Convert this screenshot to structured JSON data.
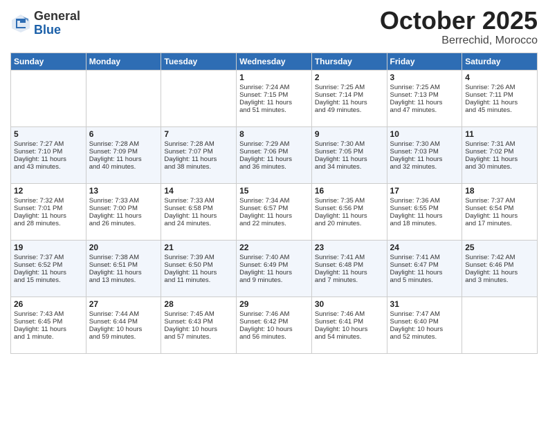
{
  "header": {
    "logo_line1": "General",
    "logo_line2": "Blue",
    "month": "October 2025",
    "location": "Berrechid, Morocco"
  },
  "weekdays": [
    "Sunday",
    "Monday",
    "Tuesday",
    "Wednesday",
    "Thursday",
    "Friday",
    "Saturday"
  ],
  "weeks": [
    [
      {
        "day": "",
        "data": ""
      },
      {
        "day": "",
        "data": ""
      },
      {
        "day": "",
        "data": ""
      },
      {
        "day": "1",
        "data": "Sunrise: 7:24 AM\nSunset: 7:15 PM\nDaylight: 11 hours\nand 51 minutes."
      },
      {
        "day": "2",
        "data": "Sunrise: 7:25 AM\nSunset: 7:14 PM\nDaylight: 11 hours\nand 49 minutes."
      },
      {
        "day": "3",
        "data": "Sunrise: 7:25 AM\nSunset: 7:13 PM\nDaylight: 11 hours\nand 47 minutes."
      },
      {
        "day": "4",
        "data": "Sunrise: 7:26 AM\nSunset: 7:11 PM\nDaylight: 11 hours\nand 45 minutes."
      }
    ],
    [
      {
        "day": "5",
        "data": "Sunrise: 7:27 AM\nSunset: 7:10 PM\nDaylight: 11 hours\nand 43 minutes."
      },
      {
        "day": "6",
        "data": "Sunrise: 7:28 AM\nSunset: 7:09 PM\nDaylight: 11 hours\nand 40 minutes."
      },
      {
        "day": "7",
        "data": "Sunrise: 7:28 AM\nSunset: 7:07 PM\nDaylight: 11 hours\nand 38 minutes."
      },
      {
        "day": "8",
        "data": "Sunrise: 7:29 AM\nSunset: 7:06 PM\nDaylight: 11 hours\nand 36 minutes."
      },
      {
        "day": "9",
        "data": "Sunrise: 7:30 AM\nSunset: 7:05 PM\nDaylight: 11 hours\nand 34 minutes."
      },
      {
        "day": "10",
        "data": "Sunrise: 7:30 AM\nSunset: 7:03 PM\nDaylight: 11 hours\nand 32 minutes."
      },
      {
        "day": "11",
        "data": "Sunrise: 7:31 AM\nSunset: 7:02 PM\nDaylight: 11 hours\nand 30 minutes."
      }
    ],
    [
      {
        "day": "12",
        "data": "Sunrise: 7:32 AM\nSunset: 7:01 PM\nDaylight: 11 hours\nand 28 minutes."
      },
      {
        "day": "13",
        "data": "Sunrise: 7:33 AM\nSunset: 7:00 PM\nDaylight: 11 hours\nand 26 minutes."
      },
      {
        "day": "14",
        "data": "Sunrise: 7:33 AM\nSunset: 6:58 PM\nDaylight: 11 hours\nand 24 minutes."
      },
      {
        "day": "15",
        "data": "Sunrise: 7:34 AM\nSunset: 6:57 PM\nDaylight: 11 hours\nand 22 minutes."
      },
      {
        "day": "16",
        "data": "Sunrise: 7:35 AM\nSunset: 6:56 PM\nDaylight: 11 hours\nand 20 minutes."
      },
      {
        "day": "17",
        "data": "Sunrise: 7:36 AM\nSunset: 6:55 PM\nDaylight: 11 hours\nand 18 minutes."
      },
      {
        "day": "18",
        "data": "Sunrise: 7:37 AM\nSunset: 6:54 PM\nDaylight: 11 hours\nand 17 minutes."
      }
    ],
    [
      {
        "day": "19",
        "data": "Sunrise: 7:37 AM\nSunset: 6:52 PM\nDaylight: 11 hours\nand 15 minutes."
      },
      {
        "day": "20",
        "data": "Sunrise: 7:38 AM\nSunset: 6:51 PM\nDaylight: 11 hours\nand 13 minutes."
      },
      {
        "day": "21",
        "data": "Sunrise: 7:39 AM\nSunset: 6:50 PM\nDaylight: 11 hours\nand 11 minutes."
      },
      {
        "day": "22",
        "data": "Sunrise: 7:40 AM\nSunset: 6:49 PM\nDaylight: 11 hours\nand 9 minutes."
      },
      {
        "day": "23",
        "data": "Sunrise: 7:41 AM\nSunset: 6:48 PM\nDaylight: 11 hours\nand 7 minutes."
      },
      {
        "day": "24",
        "data": "Sunrise: 7:41 AM\nSunset: 6:47 PM\nDaylight: 11 hours\nand 5 minutes."
      },
      {
        "day": "25",
        "data": "Sunrise: 7:42 AM\nSunset: 6:46 PM\nDaylight: 11 hours\nand 3 minutes."
      }
    ],
    [
      {
        "day": "26",
        "data": "Sunrise: 7:43 AM\nSunset: 6:45 PM\nDaylight: 11 hours\nand 1 minute."
      },
      {
        "day": "27",
        "data": "Sunrise: 7:44 AM\nSunset: 6:44 PM\nDaylight: 10 hours\nand 59 minutes."
      },
      {
        "day": "28",
        "data": "Sunrise: 7:45 AM\nSunset: 6:43 PM\nDaylight: 10 hours\nand 57 minutes."
      },
      {
        "day": "29",
        "data": "Sunrise: 7:46 AM\nSunset: 6:42 PM\nDaylight: 10 hours\nand 56 minutes."
      },
      {
        "day": "30",
        "data": "Sunrise: 7:46 AM\nSunset: 6:41 PM\nDaylight: 10 hours\nand 54 minutes."
      },
      {
        "day": "31",
        "data": "Sunrise: 7:47 AM\nSunset: 6:40 PM\nDaylight: 10 hours\nand 52 minutes."
      },
      {
        "day": "",
        "data": ""
      }
    ]
  ]
}
